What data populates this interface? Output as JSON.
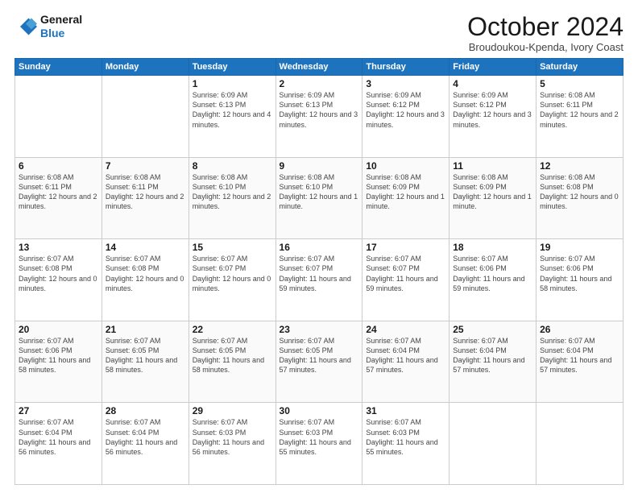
{
  "header": {
    "logo_line1": "General",
    "logo_line2": "Blue",
    "month_title": "October 2024",
    "location": "Broudoukou-Kpenda, Ivory Coast"
  },
  "days_of_week": [
    "Sunday",
    "Monday",
    "Tuesday",
    "Wednesday",
    "Thursday",
    "Friday",
    "Saturday"
  ],
  "weeks": [
    [
      {
        "day": "",
        "info": ""
      },
      {
        "day": "",
        "info": ""
      },
      {
        "day": "1",
        "info": "Sunrise: 6:09 AM\nSunset: 6:13 PM\nDaylight: 12 hours\nand 4 minutes."
      },
      {
        "day": "2",
        "info": "Sunrise: 6:09 AM\nSunset: 6:13 PM\nDaylight: 12 hours\nand 3 minutes."
      },
      {
        "day": "3",
        "info": "Sunrise: 6:09 AM\nSunset: 6:12 PM\nDaylight: 12 hours\nand 3 minutes."
      },
      {
        "day": "4",
        "info": "Sunrise: 6:09 AM\nSunset: 6:12 PM\nDaylight: 12 hours\nand 3 minutes."
      },
      {
        "day": "5",
        "info": "Sunrise: 6:08 AM\nSunset: 6:11 PM\nDaylight: 12 hours\nand 2 minutes."
      }
    ],
    [
      {
        "day": "6",
        "info": "Sunrise: 6:08 AM\nSunset: 6:11 PM\nDaylight: 12 hours\nand 2 minutes."
      },
      {
        "day": "7",
        "info": "Sunrise: 6:08 AM\nSunset: 6:11 PM\nDaylight: 12 hours\nand 2 minutes."
      },
      {
        "day": "8",
        "info": "Sunrise: 6:08 AM\nSunset: 6:10 PM\nDaylight: 12 hours\nand 2 minutes."
      },
      {
        "day": "9",
        "info": "Sunrise: 6:08 AM\nSunset: 6:10 PM\nDaylight: 12 hours\nand 1 minute."
      },
      {
        "day": "10",
        "info": "Sunrise: 6:08 AM\nSunset: 6:09 PM\nDaylight: 12 hours\nand 1 minute."
      },
      {
        "day": "11",
        "info": "Sunrise: 6:08 AM\nSunset: 6:09 PM\nDaylight: 12 hours\nand 1 minute."
      },
      {
        "day": "12",
        "info": "Sunrise: 6:08 AM\nSunset: 6:08 PM\nDaylight: 12 hours\nand 0 minutes."
      }
    ],
    [
      {
        "day": "13",
        "info": "Sunrise: 6:07 AM\nSunset: 6:08 PM\nDaylight: 12 hours\nand 0 minutes."
      },
      {
        "day": "14",
        "info": "Sunrise: 6:07 AM\nSunset: 6:08 PM\nDaylight: 12 hours\nand 0 minutes."
      },
      {
        "day": "15",
        "info": "Sunrise: 6:07 AM\nSunset: 6:07 PM\nDaylight: 12 hours\nand 0 minutes."
      },
      {
        "day": "16",
        "info": "Sunrise: 6:07 AM\nSunset: 6:07 PM\nDaylight: 11 hours\nand 59 minutes."
      },
      {
        "day": "17",
        "info": "Sunrise: 6:07 AM\nSunset: 6:07 PM\nDaylight: 11 hours\nand 59 minutes."
      },
      {
        "day": "18",
        "info": "Sunrise: 6:07 AM\nSunset: 6:06 PM\nDaylight: 11 hours\nand 59 minutes."
      },
      {
        "day": "19",
        "info": "Sunrise: 6:07 AM\nSunset: 6:06 PM\nDaylight: 11 hours\nand 58 minutes."
      }
    ],
    [
      {
        "day": "20",
        "info": "Sunrise: 6:07 AM\nSunset: 6:06 PM\nDaylight: 11 hours\nand 58 minutes."
      },
      {
        "day": "21",
        "info": "Sunrise: 6:07 AM\nSunset: 6:05 PM\nDaylight: 11 hours\nand 58 minutes."
      },
      {
        "day": "22",
        "info": "Sunrise: 6:07 AM\nSunset: 6:05 PM\nDaylight: 11 hours\nand 58 minutes."
      },
      {
        "day": "23",
        "info": "Sunrise: 6:07 AM\nSunset: 6:05 PM\nDaylight: 11 hours\nand 57 minutes."
      },
      {
        "day": "24",
        "info": "Sunrise: 6:07 AM\nSunset: 6:04 PM\nDaylight: 11 hours\nand 57 minutes."
      },
      {
        "day": "25",
        "info": "Sunrise: 6:07 AM\nSunset: 6:04 PM\nDaylight: 11 hours\nand 57 minutes."
      },
      {
        "day": "26",
        "info": "Sunrise: 6:07 AM\nSunset: 6:04 PM\nDaylight: 11 hours\nand 57 minutes."
      }
    ],
    [
      {
        "day": "27",
        "info": "Sunrise: 6:07 AM\nSunset: 6:04 PM\nDaylight: 11 hours\nand 56 minutes."
      },
      {
        "day": "28",
        "info": "Sunrise: 6:07 AM\nSunset: 6:04 PM\nDaylight: 11 hours\nand 56 minutes."
      },
      {
        "day": "29",
        "info": "Sunrise: 6:07 AM\nSunset: 6:03 PM\nDaylight: 11 hours\nand 56 minutes."
      },
      {
        "day": "30",
        "info": "Sunrise: 6:07 AM\nSunset: 6:03 PM\nDaylight: 11 hours\nand 55 minutes."
      },
      {
        "day": "31",
        "info": "Sunrise: 6:07 AM\nSunset: 6:03 PM\nDaylight: 11 hours\nand 55 minutes."
      },
      {
        "day": "",
        "info": ""
      },
      {
        "day": "",
        "info": ""
      }
    ]
  ]
}
